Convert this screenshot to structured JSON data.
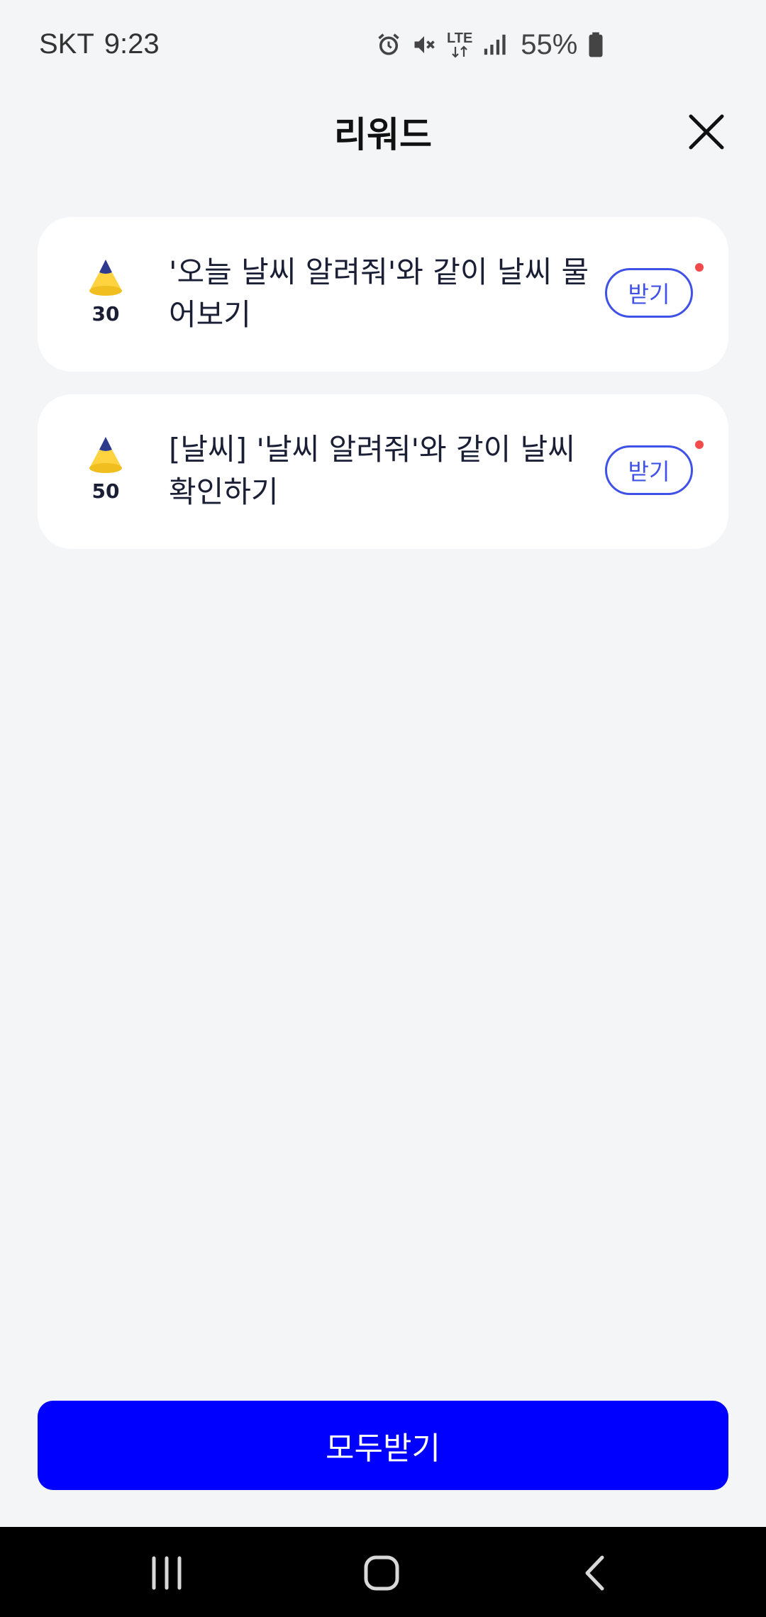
{
  "status_bar": {
    "carrier": "SKT",
    "time": "9:23",
    "network": "LTE",
    "battery": "55%",
    "icons": [
      "alarm-icon",
      "mute-icon",
      "lte-icon",
      "signal-icon",
      "battery-icon"
    ]
  },
  "header": {
    "title": "리워드",
    "close_icon": "close-icon"
  },
  "rewards": [
    {
      "amount": "30",
      "text": "'오늘 날씨 알려줘'와 같이 날씨 물어보기",
      "claim_label": "받기",
      "has_new": true
    },
    {
      "amount": "50",
      "text": "[날씨] '날씨 알려줘'와 같이 날씨 확인하기",
      "claim_label": "받기",
      "has_new": true
    }
  ],
  "footer": {
    "claim_all_label": "모두받기"
  },
  "nav_bar": {
    "icons": [
      "recents-icon",
      "home-icon",
      "back-icon"
    ]
  },
  "colors": {
    "background": "#f3f5f7",
    "accent": "#3f51e6",
    "primary_button": "#0000ff",
    "notify_dot": "#f24b4b",
    "cone_top": "#2e3a8c",
    "cone_bottom": "#ffd23f"
  }
}
